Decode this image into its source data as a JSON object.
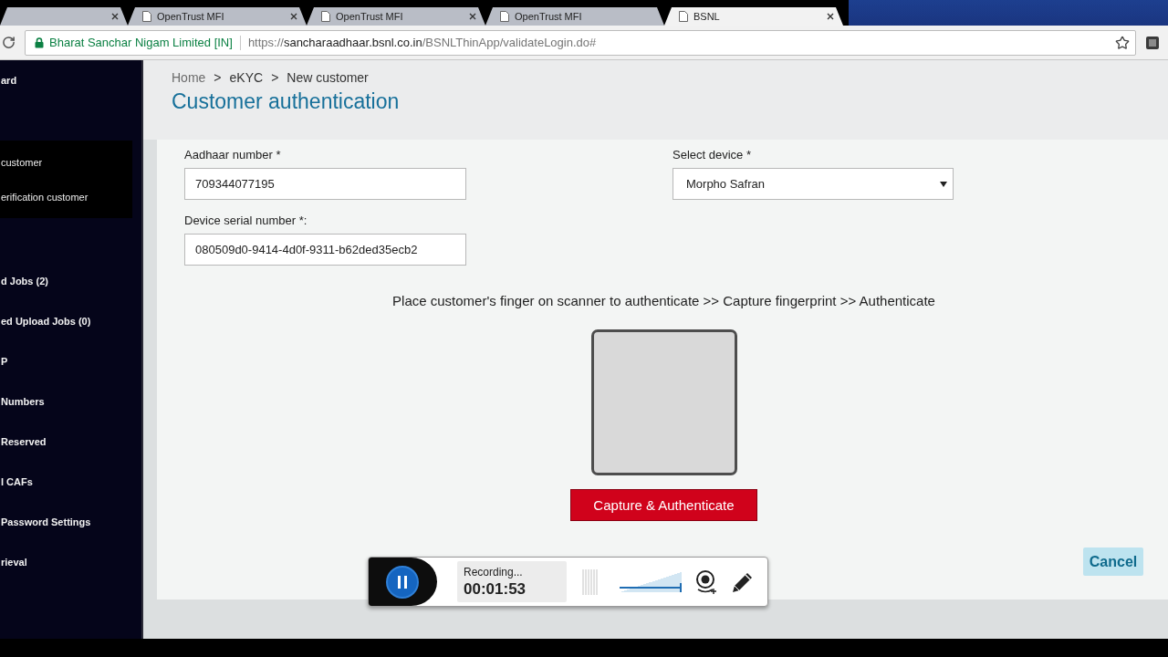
{
  "browser": {
    "tabs": [
      {
        "selected": false,
        "closable": true
      },
      {
        "label": "OpenTrust MFI",
        "selected": false,
        "closable": true
      },
      {
        "label": "OpenTrust MFI",
        "selected": false,
        "closable": true
      },
      {
        "label": "OpenTrust MFI",
        "selected": false,
        "closable": false
      },
      {
        "label": "BSNL",
        "selected": true,
        "closable": true
      }
    ],
    "site_identity": "Bharat Sanchar Nigam Limited [IN]",
    "url": [
      {
        "text": "https://",
        "emphasized": false
      },
      {
        "text": "sancharaadhaar.bsnl.co.in",
        "emphasized": true
      },
      {
        "text": "/BSNLThinApp/validateLogin.do#",
        "emphasized": false
      }
    ],
    "bookmarked": false
  },
  "sidebar": {
    "items": [
      {
        "kind": "link",
        "label": "ard"
      },
      {
        "kind": "submenu",
        "items": [
          {
            "label": "customer"
          },
          {
            "label": "erification customer"
          }
        ]
      },
      {
        "kind": "link",
        "label": "d Jobs (2)"
      },
      {
        "kind": "link",
        "label": "ed Upload Jobs (0)"
      },
      {
        "kind": "link",
        "label": "P"
      },
      {
        "kind": "link",
        "label": "Numbers"
      },
      {
        "kind": "link",
        "label": "Reserved"
      },
      {
        "kind": "link",
        "label": "l CAFs"
      },
      {
        "kind": "link",
        "label": "Password Settings"
      },
      {
        "kind": "link",
        "label": "rieval"
      }
    ]
  },
  "page": {
    "breadcrumb": [
      {
        "kind": "link",
        "text": "Home"
      },
      {
        "kind": "separator",
        "text": ">"
      },
      {
        "kind": "section",
        "text": "eKYC"
      },
      {
        "kind": "separator",
        "text": ">"
      },
      {
        "kind": "current",
        "text": "New customer"
      }
    ],
    "title": "Customer authentication"
  },
  "form": {
    "columns": [
      [
        {
          "kind": "text",
          "label": "Aadhaar number *",
          "value": "709344077195"
        },
        {
          "kind": "text",
          "label": "Device serial number *:",
          "value": "080509d0-9414-4d0f-9311-b62ded35ecb2"
        }
      ],
      [
        {
          "kind": "select",
          "label": "Select device *",
          "value": "Morpho Safran"
        }
      ]
    ]
  },
  "instruction": "Place customer's finger on scanner to authenticate >> Capture fingerprint >> Authenticate",
  "capture_button": "Capture & Authenticate",
  "cancel_button": "Cancel",
  "recorder": {
    "status": "Recording...",
    "time": "00:01:53",
    "volume": {
      "level": 1
    }
  }
}
